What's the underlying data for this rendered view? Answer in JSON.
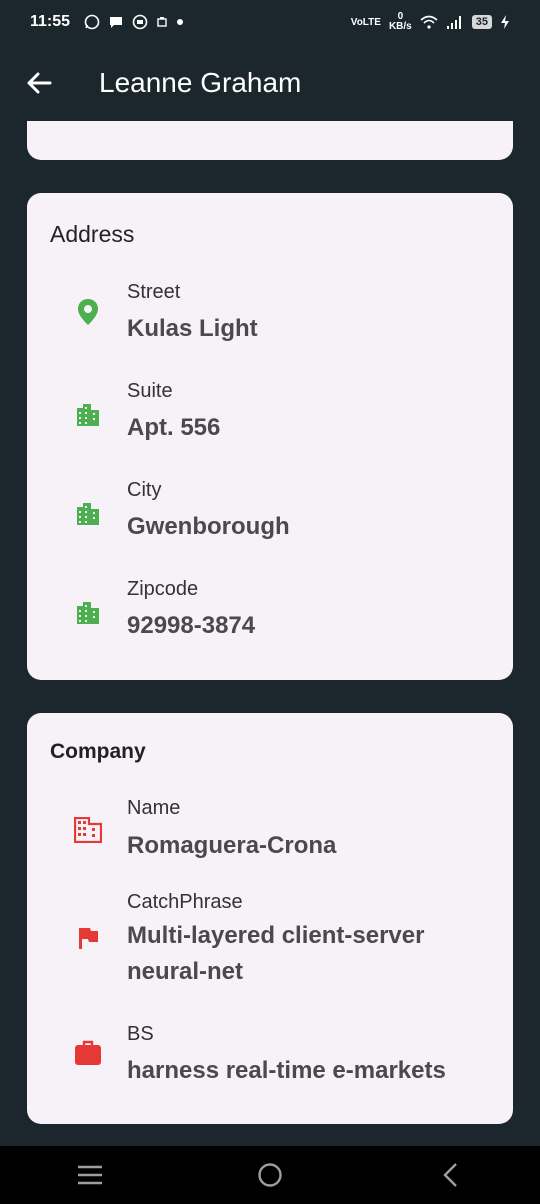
{
  "status_bar": {
    "time": "11:55",
    "icons_left": [
      "whatsapp-icon",
      "messages-icon",
      "chat-icon",
      "notification-icon",
      "dot-icon"
    ],
    "network": "VoLTE",
    "speed_value": "0",
    "speed_unit": "KB/s",
    "battery": "35"
  },
  "app_bar": {
    "title": "Leanne Graham",
    "back_icon": "arrow-back-icon"
  },
  "address": {
    "title": "Address",
    "rows": [
      {
        "label": "Street",
        "value": "Kulas Light",
        "icon": "location-pin-icon",
        "color": "#4caf50"
      },
      {
        "label": "Suite",
        "value": "Apt. 556",
        "icon": "building-icon",
        "color": "#4caf50"
      },
      {
        "label": "City",
        "value": "Gwenborough",
        "icon": "building-icon",
        "color": "#4caf50"
      },
      {
        "label": "Zipcode",
        "value": "92998-3874",
        "icon": "building-icon",
        "color": "#4caf50"
      }
    ]
  },
  "company": {
    "title": "Company",
    "rows": [
      {
        "label": "Name",
        "value": "Romaguera-Crona",
        "icon": "business-icon",
        "color": "#e53935"
      },
      {
        "label": "CatchPhrase",
        "value": "Multi-layered client-server neural-net",
        "icon": "flag-icon",
        "color": "#e53935"
      },
      {
        "label": "BS",
        "value": "harness real-time e-markets",
        "icon": "briefcase-icon",
        "color": "#e53935"
      }
    ]
  },
  "nav_bar": {
    "buttons": [
      "menu-icon",
      "home-icon",
      "back-icon"
    ]
  }
}
